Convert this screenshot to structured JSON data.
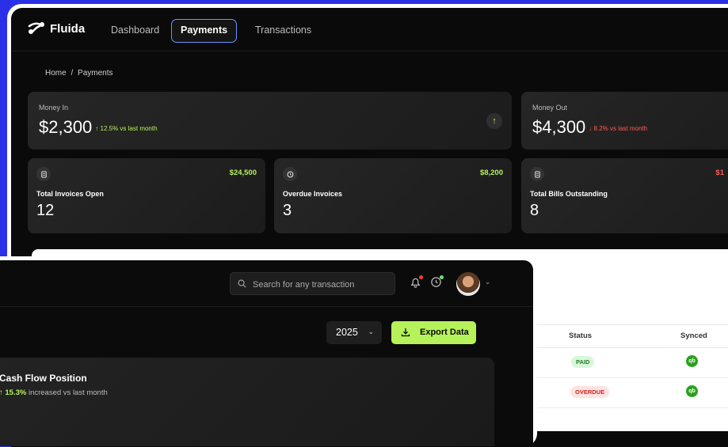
{
  "app": {
    "name": "Fluida"
  },
  "nav": [
    {
      "label": "Dashboard",
      "active": false
    },
    {
      "label": "Payments",
      "active": true
    },
    {
      "label": "Transactions",
      "active": false
    }
  ],
  "breadcrumb": {
    "home": "Home",
    "separator": "/",
    "current": "Payments"
  },
  "money_in": {
    "label": "Money In",
    "value": "$2,300",
    "change": "↑ 12.5% vs last month",
    "direction": "up"
  },
  "money_out": {
    "label": "Money Out",
    "value": "$4,300",
    "change": "↓ 8.2% vs last month",
    "direction": "down"
  },
  "stats": [
    {
      "label": "Total Invoices Open",
      "count": "12",
      "amount": "$24,500",
      "icon": "document-icon"
    },
    {
      "label": "Overdue Invoices",
      "count": "3",
      "amount": "$8,200",
      "icon": "clock-icon"
    },
    {
      "label": "Total Bills Outstanding",
      "count": "8",
      "amount": "$1",
      "icon": "document-icon"
    }
  ],
  "table": {
    "columns": [
      "Status",
      "Synced"
    ],
    "rows": [
      {
        "status": "PAID",
        "synced_icon": "qb"
      },
      {
        "status": "OVERDUE",
        "synced_icon": "qb"
      }
    ]
  },
  "search": {
    "placeholder": "Search for any transaction"
  },
  "year_select": {
    "value": "2025"
  },
  "export": {
    "label": "Export Data"
  },
  "cashflow": {
    "title": "Cash Flow Position",
    "change_pct": "15.3%",
    "change_text": "increased vs last month",
    "arrow": "↑"
  },
  "colors": {
    "accent": "#b6f25a",
    "negative": "#ff5a5a",
    "nav_active_border": "#6a94ff",
    "background": "#2a2fe8"
  }
}
